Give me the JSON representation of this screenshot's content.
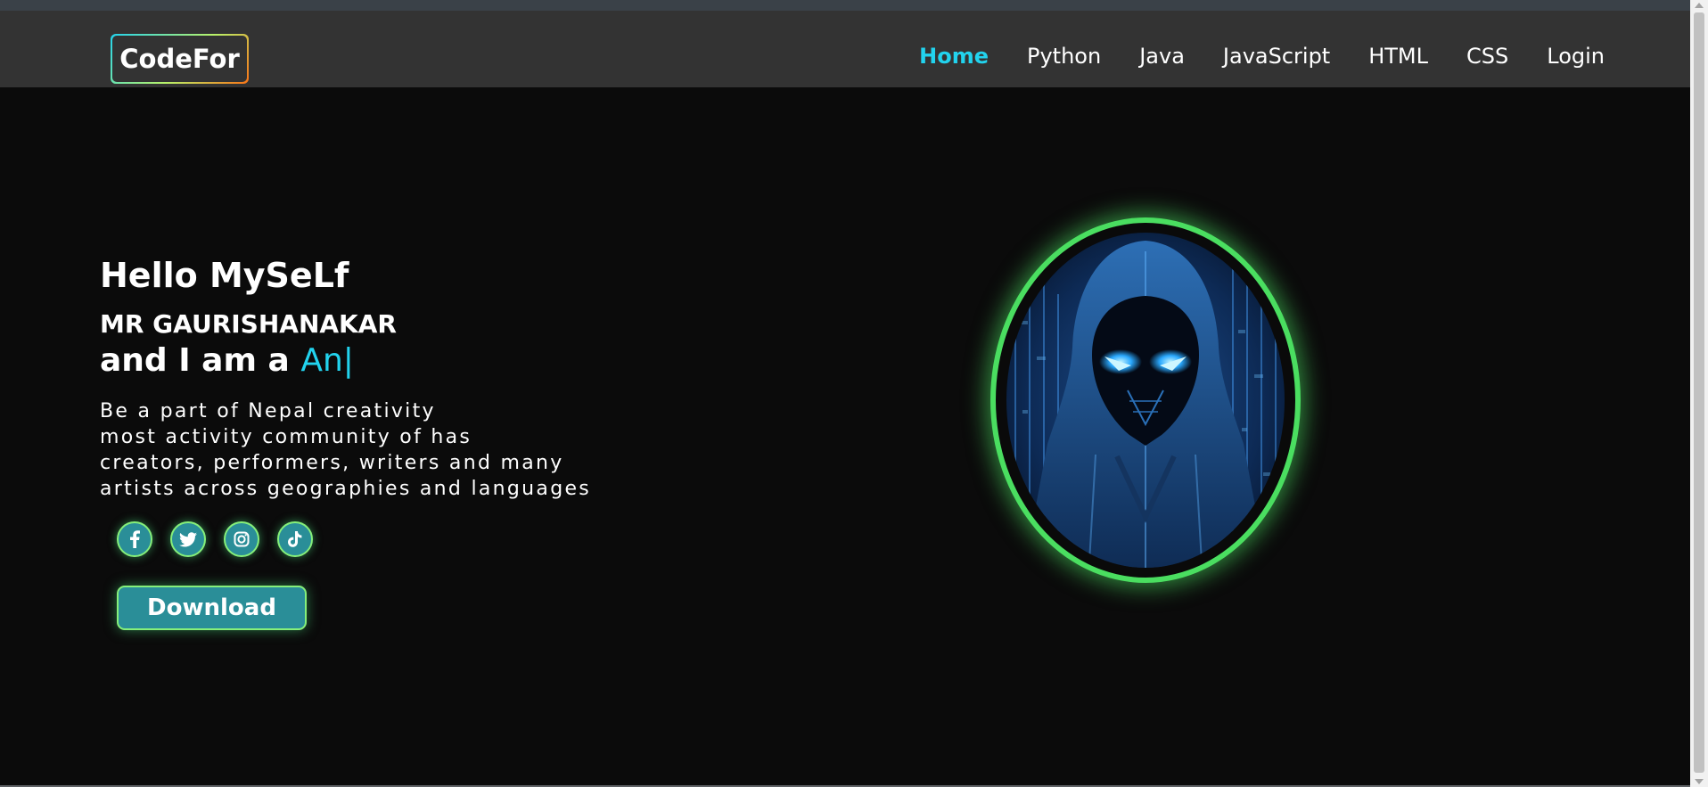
{
  "nav": {
    "logo": "CodeFor",
    "links": [
      "Home",
      "Python",
      "Java",
      "JavaScript",
      "HTML",
      "CSS",
      "Login"
    ],
    "active": "Home"
  },
  "hero": {
    "greeting": "Hello MySeLf",
    "name": "MR GAURISHANAKAR",
    "role_prefix": "and I am a",
    "role_typed": "An",
    "cursor": "|",
    "description": [
      "Be a part of Nepal creativity",
      "most activity community of has",
      "creators, performers, writers and many",
      "artists across geographies and languages"
    ],
    "download_label": "Download"
  },
  "socials": [
    "facebook-icon",
    "twitter-icon",
    "instagram-icon",
    "tiktok-icon"
  ],
  "colors": {
    "accent": "#22d3ee",
    "glow": "#4ade60",
    "button": "#2a8e98",
    "navbar": "#333333",
    "background": "#0b0b0b"
  }
}
